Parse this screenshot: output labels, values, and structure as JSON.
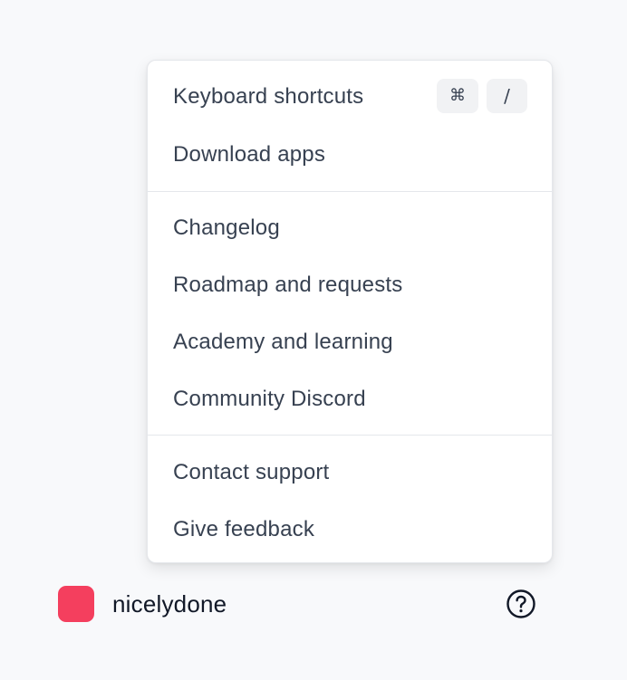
{
  "menu": {
    "groups": [
      {
        "items": [
          {
            "label": "Keyboard shortcuts",
            "shortcut": [
              "⌘",
              "/"
            ]
          },
          {
            "label": "Download apps"
          }
        ]
      },
      {
        "items": [
          {
            "label": "Changelog"
          },
          {
            "label": "Roadmap and requests"
          },
          {
            "label": "Academy and learning"
          },
          {
            "label": "Community Discord"
          }
        ]
      },
      {
        "items": [
          {
            "label": "Contact support"
          },
          {
            "label": "Give feedback"
          }
        ]
      }
    ]
  },
  "footer": {
    "workspace_name": "nicelydone",
    "avatar_color": "#f43f5e",
    "help_icon": "question-circle-icon"
  }
}
